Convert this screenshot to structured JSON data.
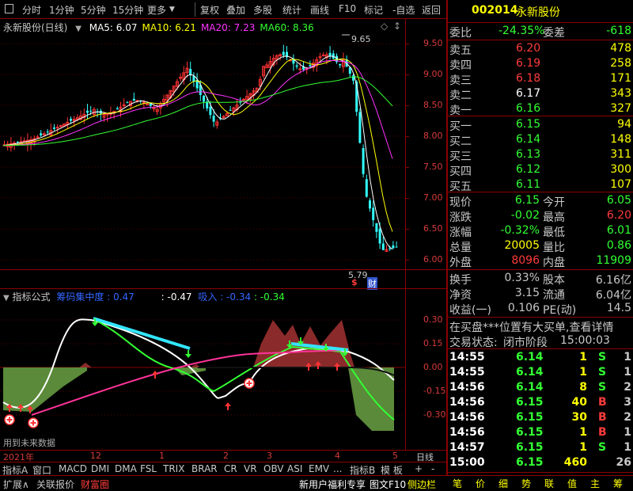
{
  "toolbar": {
    "period_tabs": [
      "分时",
      "1分钟",
      "5分钟",
      "15分钟",
      "更多"
    ],
    "actions": [
      "复权",
      "叠加",
      "多股",
      "统计",
      "画线",
      "F10",
      "标记",
      "-自选",
      "返回"
    ]
  },
  "main_chart": {
    "title": "永新股份(日线)",
    "ma_labels": [
      {
        "text": "MA5: 6.07",
        "color": "#ffffff"
      },
      {
        "text": "MA10: 6.21",
        "color": "#ffff00"
      },
      {
        "text": "MA20: 7.23",
        "color": "#ff33ff"
      },
      {
        "text": "MA60: 8.36",
        "color": "#33ff33"
      }
    ],
    "high_label": "9.65",
    "low_label": "5.79",
    "badge_s": "$",
    "badge_cai": "财",
    "price_ticks": [
      "9.50",
      "9.00",
      "8.50",
      "8.00",
      "7.50",
      "7.00",
      "6.50",
      "6.00"
    ]
  },
  "indicator": {
    "title": "指标公式",
    "name": "筹码集中度",
    "val1": ": 0.47",
    "val2": ": -0.47",
    "name2": "吸入",
    "val3": ": -0.34",
    "val4": ": -0.34",
    "ticks": [
      "0.30",
      "0.15",
      "0.00",
      "-0.15",
      "-0.30"
    ],
    "future_note": "用到未来数据"
  },
  "date_axis": {
    "year": "2021年",
    "marks": [
      "12",
      "1",
      "2",
      "3",
      "4",
      "5"
    ],
    "right_label": "日线"
  },
  "indicator_tabs": [
    "指标A",
    "窗口",
    "MACD",
    "DMI",
    "DMA",
    "FSL",
    "TRIX",
    "BRAR",
    "CR",
    "VR",
    "OBV",
    "ASI",
    "EMV",
    "...",
    "指标B",
    "模 板",
    "+",
    "-"
  ],
  "bottom_tabs": [
    "扩展∧",
    "关联报价",
    "财富圈"
  ],
  "bottom_right": [
    "新用户福利专享",
    "图文F10",
    "侧边栏"
  ],
  "stock": {
    "code": "002014",
    "name": "永新股份",
    "weibi_label": "委比",
    "weibi": "-24.35%",
    "weicha_label": "委差",
    "weicha": "-618",
    "sells": [
      {
        "label": "卖五",
        "price": "6.20",
        "vol": "478",
        "pcolor": "#ff3b3b"
      },
      {
        "label": "卖四",
        "price": "6.19",
        "vol": "258",
        "pcolor": "#ff3b3b"
      },
      {
        "label": "卖三",
        "price": "6.18",
        "vol": "171",
        "pcolor": "#ff3b3b"
      },
      {
        "label": "卖二",
        "price": "6.17",
        "vol": "343",
        "pcolor": "#ffffff"
      },
      {
        "label": "卖一",
        "price": "6.16",
        "vol": "327",
        "pcolor": "#33ff33"
      }
    ],
    "buys": [
      {
        "label": "买一",
        "price": "6.15",
        "vol": "94"
      },
      {
        "label": "买二",
        "price": "6.14",
        "vol": "148"
      },
      {
        "label": "买三",
        "price": "6.13",
        "vol": "311"
      },
      {
        "label": "买四",
        "price": "6.12",
        "vol": "300"
      },
      {
        "label": "买五",
        "price": "6.11",
        "vol": "107"
      }
    ],
    "quote": [
      {
        "l1": "现价",
        "v1": "6.15",
        "c1": "#33ff33",
        "l2": "今开",
        "v2": "6.05",
        "c2": "#33ff33"
      },
      {
        "l1": "涨跌",
        "v1": "-0.02",
        "c1": "#33ff33",
        "l2": "最高",
        "v2": "6.20",
        "c2": "#ff3b3b"
      },
      {
        "l1": "涨幅",
        "v1": "-0.32%",
        "c1": "#33ff33",
        "l2": "最低",
        "v2": "6.01",
        "c2": "#33ff33"
      },
      {
        "l1": "总量",
        "v1": "20005",
        "c1": "#ffff00",
        "l2": "量比",
        "v2": "0.86",
        "c2": "#33ff33"
      },
      {
        "l1": "外盘",
        "v1": "8096",
        "c1": "#ff3b3b",
        "l2": "内盘",
        "v2": "11909",
        "c2": "#33ff33"
      }
    ],
    "stats": [
      {
        "l1": "换手",
        "v1": "0.33%",
        "l2": "股本",
        "v2": "6.16亿"
      },
      {
        "l1": "净资",
        "v1": "3.15",
        "l2": "流通",
        "v2": "6.04亿"
      },
      {
        "l1": "收益(一)",
        "v1": "0.106",
        "l2": "PE(动)",
        "v2": "14.5"
      }
    ],
    "notice": "在买盘***位置有大买单,查看详情",
    "status_label": "交易状态:",
    "status": "闭市阶段",
    "status_time": "15:00:03",
    "ticks": [
      {
        "t": "14:55",
        "p": "6.14",
        "v": "1",
        "s": "S",
        "n": "1",
        "sc": "#33ff33"
      },
      {
        "t": "14:55",
        "p": "6.14",
        "v": "1",
        "s": "S",
        "n": "1",
        "sc": "#33ff33"
      },
      {
        "t": "14:56",
        "p": "6.14",
        "v": "8",
        "s": "S",
        "n": "2",
        "sc": "#33ff33"
      },
      {
        "t": "14:56",
        "p": "6.15",
        "v": "40",
        "s": "B",
        "n": "3",
        "sc": "#ff3b3b"
      },
      {
        "t": "14:56",
        "p": "6.15",
        "v": "30",
        "s": "B",
        "n": "2",
        "sc": "#ff3b3b"
      },
      {
        "t": "14:56",
        "p": "6.15",
        "v": "1",
        "s": "B",
        "n": "1",
        "sc": "#ff3b3b"
      },
      {
        "t": "14:57",
        "p": "6.15",
        "v": "1",
        "s": "S",
        "n": "1",
        "sc": "#33ff33"
      },
      {
        "t": "15:00",
        "p": "6.15",
        "v": "460",
        "s": "",
        "n": "26",
        "sc": "#33ff33"
      }
    ],
    "bottom_buttons": [
      "笔",
      "价",
      "细",
      "势",
      "联",
      "值",
      "主",
      "筹"
    ]
  }
}
